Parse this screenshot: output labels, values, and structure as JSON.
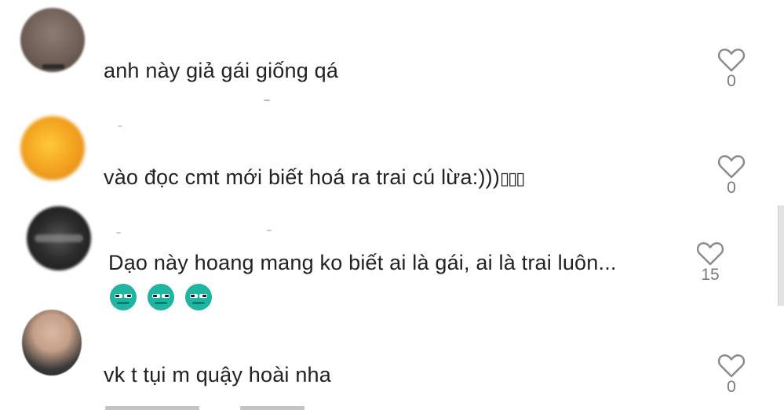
{
  "comments": [
    {
      "text": "anh này giả gái giống qá",
      "likes": "0"
    },
    {
      "text": "vào đọc cmt mới biết hoá ra trai cú lừa:)))",
      "text_tail": "▯▯▯",
      "likes": "0"
    },
    {
      "text": "Dạo này hoang mang ko biết ai là gái, ai là trai luôn...",
      "emoji_count": 3,
      "likes": "15"
    },
    {
      "text": "vk t tụi m quậy hoài nha",
      "likes": "0"
    }
  ],
  "icons": {
    "like": "heart-outline-icon",
    "reaction": "teal-smirk-emoji"
  },
  "colors": {
    "text": "#222222",
    "count": "#7a7a7a",
    "emoji": "#1fb5a0",
    "heart_stroke": "#8a8a8a"
  }
}
